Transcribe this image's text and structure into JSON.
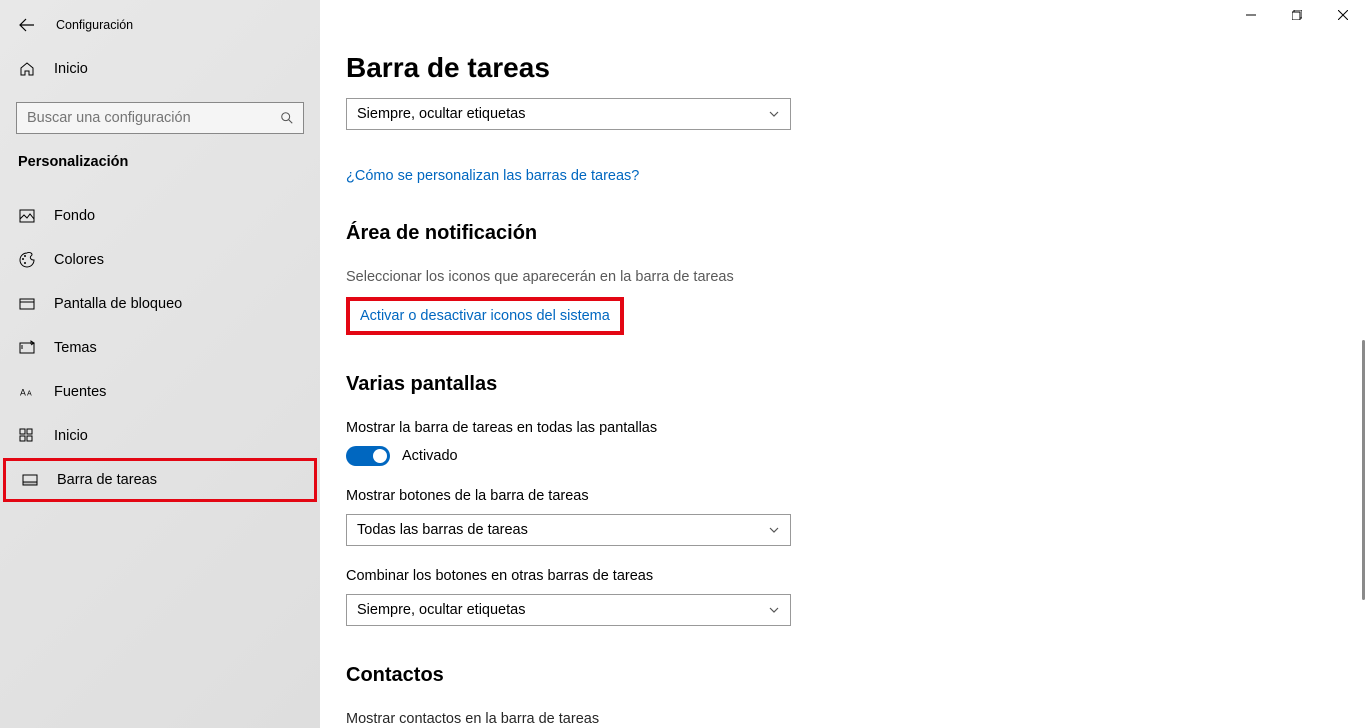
{
  "window": {
    "title": "Configuración"
  },
  "sidebar": {
    "home": "Inicio",
    "search_placeholder": "Buscar una configuración",
    "category": "Personalización",
    "items": [
      {
        "label": "Fondo"
      },
      {
        "label": "Colores"
      },
      {
        "label": "Pantalla de bloqueo"
      },
      {
        "label": "Temas"
      },
      {
        "label": "Fuentes"
      },
      {
        "label": "Inicio"
      },
      {
        "label": "Barra de tareas"
      }
    ]
  },
  "main": {
    "title": "Barra de tareas",
    "dropdown1_value": "Siempre, ocultar etiquetas",
    "link_customize": "¿Cómo se personalizan las barras de tareas?",
    "section_notification": "Área de notificación",
    "select_icons_text": "Seleccionar los iconos que aparecerán en la barra de tareas",
    "link_system_icons": "Activar o desactivar iconos del sistema",
    "section_multiple": "Varias pantallas",
    "show_taskbar_all": "Mostrar la barra de tareas en todas las pantallas",
    "toggle_state": "Activado",
    "show_buttons_label": "Mostrar botones de la barra de tareas",
    "dropdown2_value": "Todas las barras de tareas",
    "combine_buttons_label": "Combinar los botones en otras barras de tareas",
    "dropdown3_value": "Siempre, ocultar etiquetas",
    "section_contacts": "Contactos",
    "show_contacts_text": "Mostrar contactos en la barra de tareas"
  }
}
